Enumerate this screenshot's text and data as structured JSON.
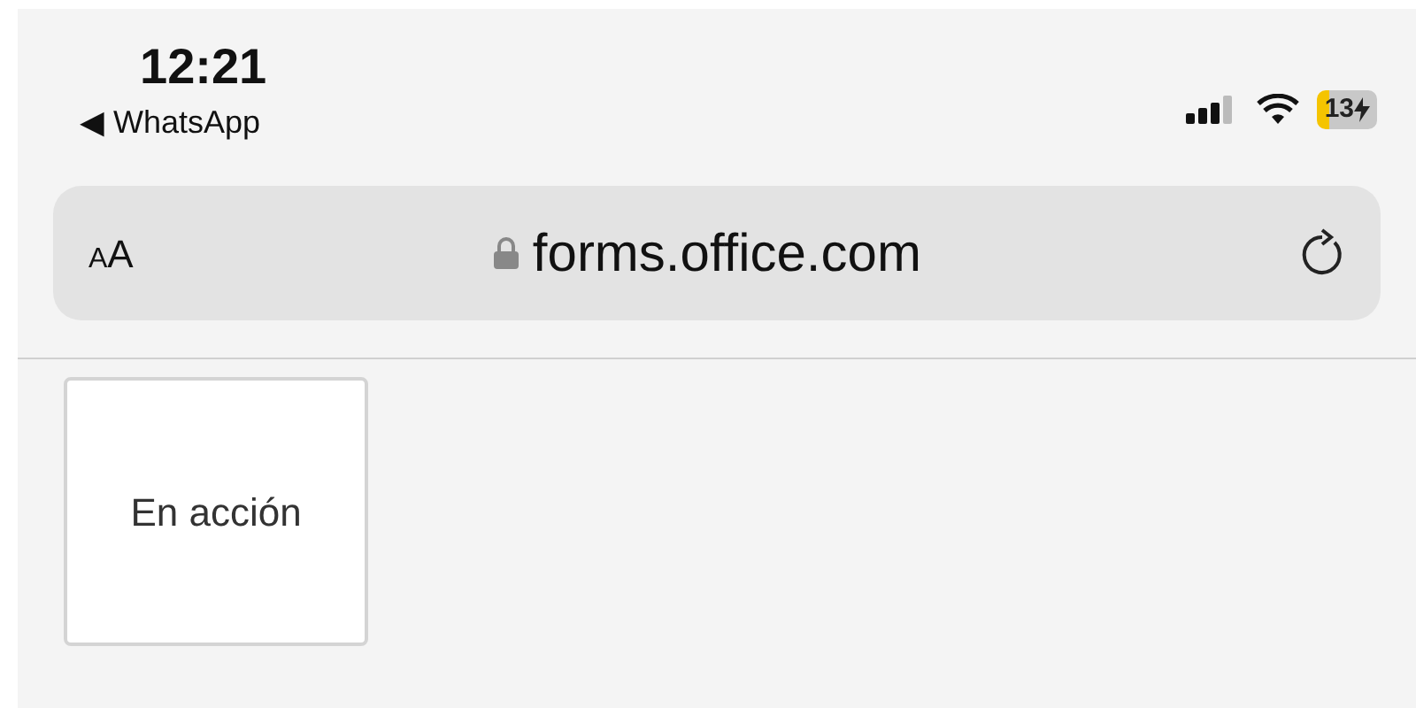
{
  "status_bar": {
    "time": "12:21",
    "back_app": "◀ WhatsApp",
    "battery": "13"
  },
  "address_bar": {
    "text_size": "AA",
    "url": "forms.office.com"
  },
  "content": {
    "options": [
      {
        "label": "En acción"
      }
    ]
  }
}
